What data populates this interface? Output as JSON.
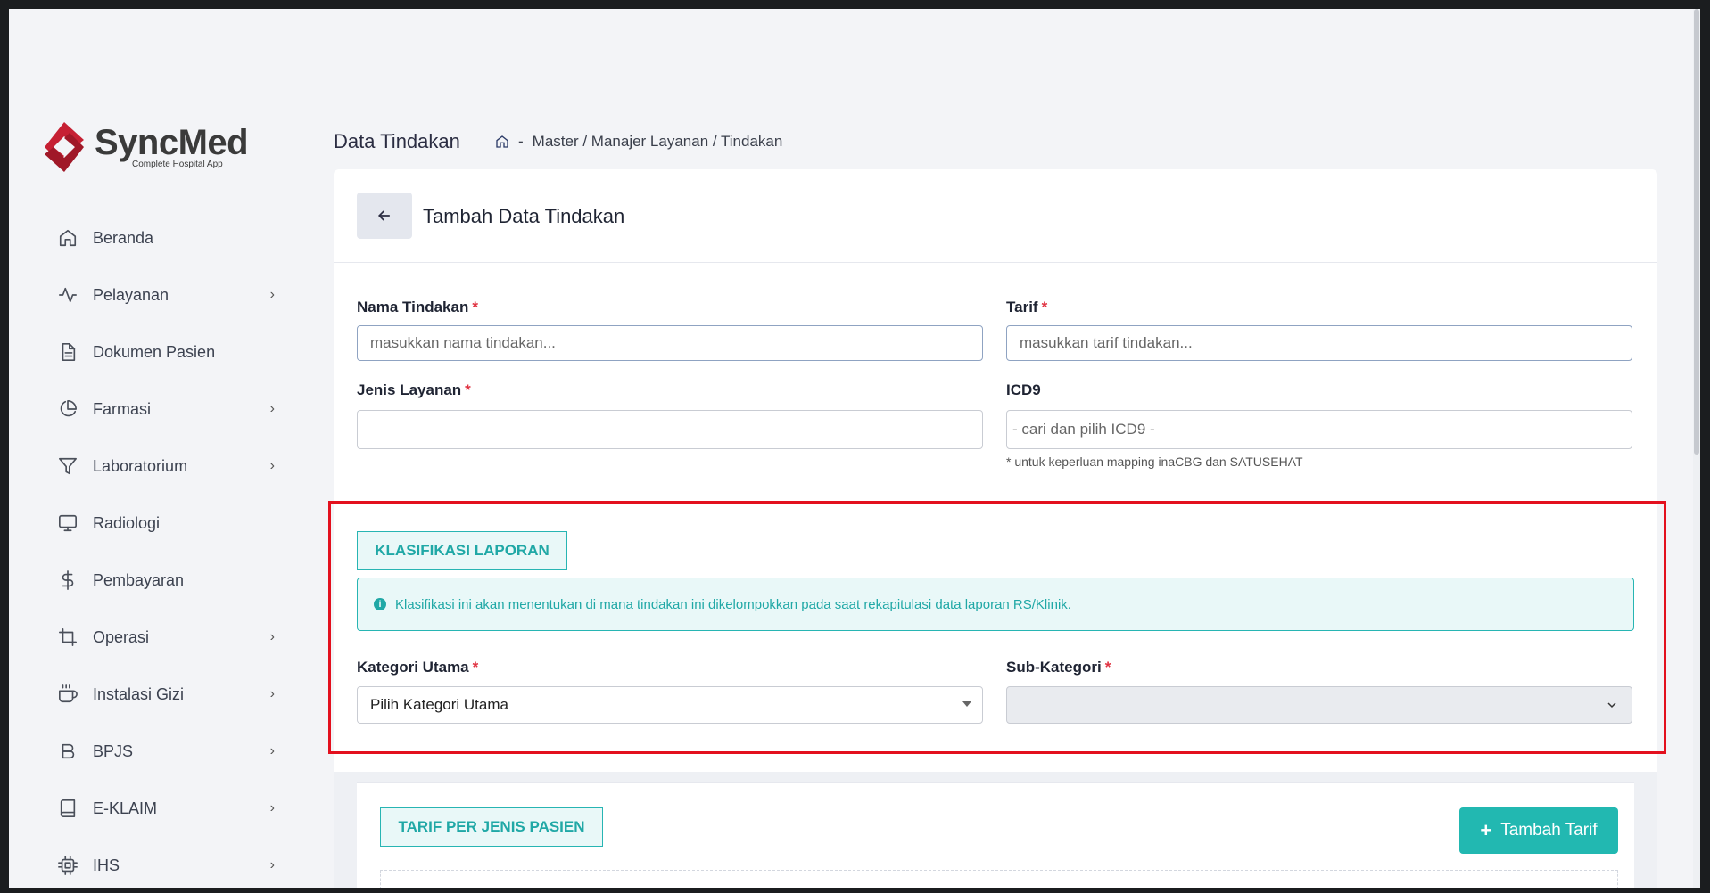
{
  "brand": {
    "name": "SyncMed",
    "tagline": "Complete Hospital App",
    "accent": "#c62033"
  },
  "sidebar": {
    "items": [
      {
        "label": "Beranda",
        "icon": "home-icon",
        "has_children": false
      },
      {
        "label": "Pelayanan",
        "icon": "activity-icon",
        "has_children": true
      },
      {
        "label": "Dokumen Pasien",
        "icon": "document-icon",
        "has_children": false
      },
      {
        "label": "Farmasi",
        "icon": "pie-chart-icon",
        "has_children": true
      },
      {
        "label": "Laboratorium",
        "icon": "filter-icon",
        "has_children": true
      },
      {
        "label": "Radiologi",
        "icon": "monitor-icon",
        "has_children": false
      },
      {
        "label": "Pembayaran",
        "icon": "dollar-icon",
        "has_children": false
      },
      {
        "label": "Operasi",
        "icon": "crop-icon",
        "has_children": true
      },
      {
        "label": "Instalasi Gizi",
        "icon": "coffee-icon",
        "has_children": true
      },
      {
        "label": "BPJS",
        "icon": "bold-b-icon",
        "has_children": true
      },
      {
        "label": "E-KLAIM",
        "icon": "book-icon",
        "has_children": true
      },
      {
        "label": "IHS",
        "icon": "cpu-icon",
        "has_children": true
      }
    ],
    "chevron": "›"
  },
  "header": {
    "title": "Data Tindakan",
    "breadcrumb_sep": "-",
    "breadcrumb": "Master / Manajer Layanan / Tindakan"
  },
  "form": {
    "title": "Tambah Data Tindakan",
    "required_mark": "*",
    "nama_tindakan": {
      "label": "Nama Tindakan",
      "placeholder": "masukkan nama tindakan..."
    },
    "tarif": {
      "label": "Tarif",
      "placeholder": "masukkan tarif tindakan..."
    },
    "jenis_layanan": {
      "label": "Jenis Layanan",
      "value": ""
    },
    "icd9": {
      "label": "ICD9",
      "placeholder": "- cari dan pilih  ICD9 -",
      "hint": "* untuk keperluan mapping inaCBG dan SATUSEHAT"
    }
  },
  "klasifikasi": {
    "title": "KLASIFIKASI LAPORAN",
    "info_icon": "i",
    "info": "Klasifikasi ini akan menentukan di mana tindakan ini dikelompokkan pada saat rekapitulasi data laporan RS/Klinik.",
    "kategori_utama": {
      "label": "Kategori Utama",
      "value": "Pilih Kategori Utama"
    },
    "sub_kategori": {
      "label": "Sub-Kategori",
      "value": ""
    }
  },
  "tarif_section": {
    "title": "TARIF PER JENIS PASIEN",
    "add_icon": "+",
    "add_label": "Tambah Tarif"
  },
  "colors": {
    "teal": "#22b8b1",
    "highlight": "#e3101e",
    "required": "#e03140"
  }
}
